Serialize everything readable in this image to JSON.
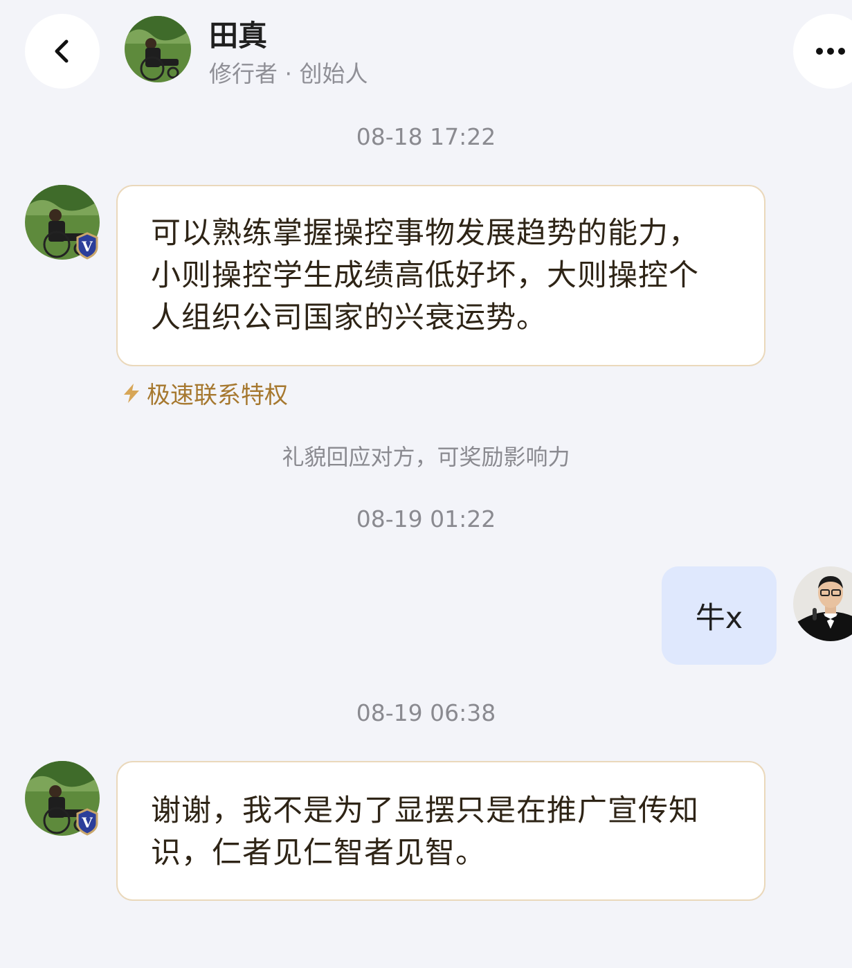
{
  "header": {
    "back_icon": "chevron-left-icon",
    "more_icon": "more-horizontal-icon",
    "name": "田真",
    "subtitle": "修行者 · 创始人"
  },
  "messages": [
    {
      "type": "timestamp",
      "text": "08-18 17:22"
    },
    {
      "type": "incoming",
      "verified": true,
      "lines": [
        "可以熟练掌握操控事物发展趋势的能力，",
        "小则操控学生成绩高低好坏，大则操控个",
        "人组织公司国家的兴衰运势。"
      ]
    },
    {
      "type": "privilege",
      "icon": "lightning-icon",
      "text": "极速联系特权"
    },
    {
      "type": "hint",
      "text": "礼貌回应对方，可奖励影响力"
    },
    {
      "type": "timestamp",
      "text": "08-19 01:22"
    },
    {
      "type": "outgoing",
      "text": "牛x"
    },
    {
      "type": "timestamp",
      "text": "08-19 06:38"
    },
    {
      "type": "incoming",
      "verified": true,
      "lines": [
        "谢谢，我不是为了显摆只是在推广宣传知",
        "识，仁者见仁智者见智。"
      ]
    }
  ],
  "colors": {
    "background": "#f3f4f9",
    "incoming_bubble": "#ffffff",
    "incoming_border": "#ead8bb",
    "outgoing_bubble": "#dfe8fd",
    "privilege_text": "#a6782f",
    "timestamp_text": "#8a8a90"
  }
}
